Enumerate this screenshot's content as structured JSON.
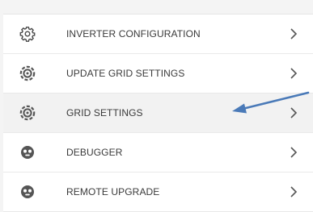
{
  "menu": {
    "items": [
      {
        "label": "INVERTER CONFIGURATION",
        "icon": "gear-outline-icon"
      },
      {
        "label": "UPDATE GRID SETTINGS",
        "icon": "target-gear-icon"
      },
      {
        "label": "GRID SETTINGS",
        "icon": "target-gear-icon",
        "highlighted": true
      },
      {
        "label": "DEBUGGER",
        "icon": "bug-face-icon"
      },
      {
        "label": "REMOTE UPGRADE",
        "icon": "bug-face-icon"
      }
    ],
    "chevron_icon": "chevron-right-icon"
  },
  "annotation": {
    "type": "arrow",
    "color": "#4a7ab8",
    "points_to": "GRID SETTINGS"
  }
}
